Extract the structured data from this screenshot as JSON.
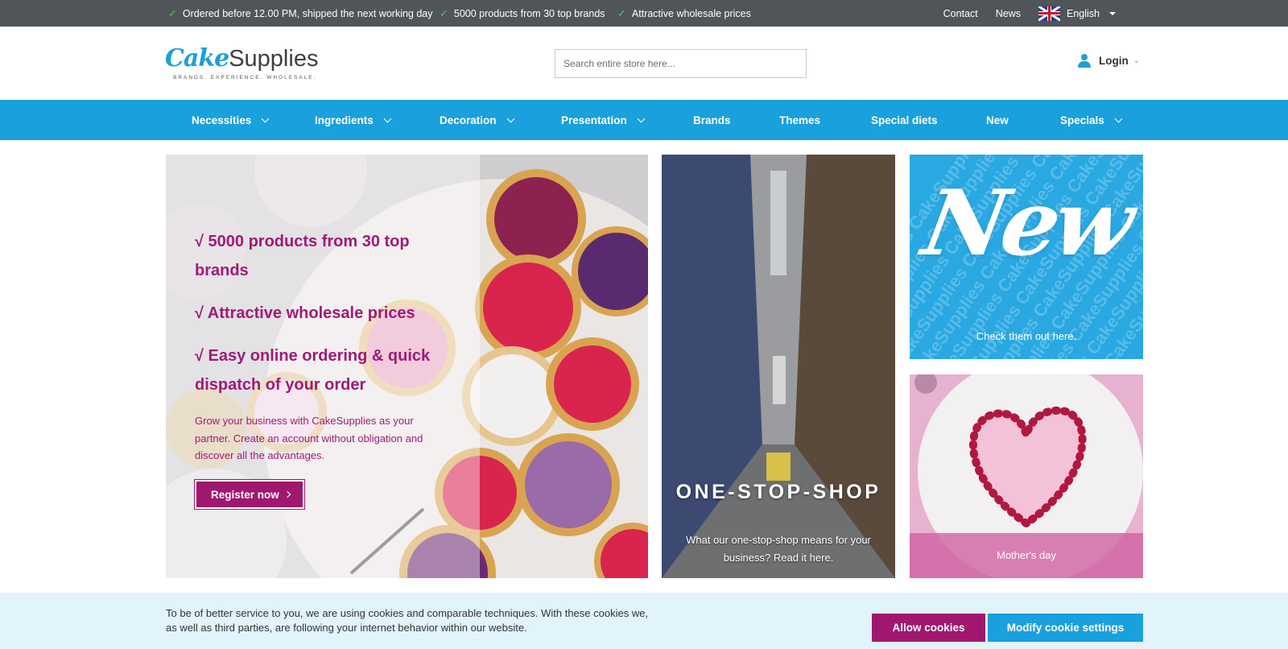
{
  "topbar": {
    "usps": [
      "Ordered before 12.00 PM, shipped the next working day",
      "5000 products from 30 top brands",
      "Attractive wholesale prices"
    ],
    "links": {
      "contact": "Contact",
      "news": "News"
    },
    "language": "English",
    "usp_icon": "check-icon"
  },
  "header": {
    "logo": {
      "part1": "Cake",
      "part2": "Supplies",
      "tagline": "BRANDS. EXPERIENCE. WHOLESALE."
    },
    "search_placeholder": "Search entire store here...",
    "login_label": "Login"
  },
  "nav": {
    "items": [
      {
        "label": "Necessities",
        "dropdown": true
      },
      {
        "label": "Ingredients",
        "dropdown": true
      },
      {
        "label": "Decoration",
        "dropdown": true
      },
      {
        "label": "Presentation",
        "dropdown": true
      },
      {
        "label": "Brands",
        "dropdown": false
      },
      {
        "label": "Themes",
        "dropdown": false
      },
      {
        "label": "Special diets",
        "dropdown": false
      },
      {
        "label": "New",
        "dropdown": false
      },
      {
        "label": "Specials",
        "dropdown": true
      }
    ]
  },
  "hero": {
    "points": [
      "√ 5000 products from 30 top brands",
      "√ Attractive wholesale prices",
      "√ Easy online ordering & quick dispatch of your order"
    ],
    "intro": "Grow your business with CakeSupplies as your partner. Create an account without obligation and discover all the advantages.",
    "button_label": "Register now"
  },
  "tiles": {
    "shop": {
      "title": "ONE-STOP-SHOP",
      "subtitle": "What our one-stop-shop means for your business? Read it here."
    },
    "new": {
      "title": "New",
      "subtitle": "Check them out here."
    },
    "mothers_day": {
      "subtitle": "Mother's day"
    }
  },
  "cookie": {
    "text": "To be of better service to you, we are using cookies and comparable techniques. With these cookies we, as well as third parties, are following your internet behavior within our website.",
    "allow_label": "Allow cookies",
    "modify_label": "Modify cookie settings"
  },
  "colors": {
    "topbar": "#4f5558",
    "brand_blue": "#1aa0dc",
    "brand_magenta": "#a0176f",
    "cookie_bg": "#e1f3fb"
  }
}
